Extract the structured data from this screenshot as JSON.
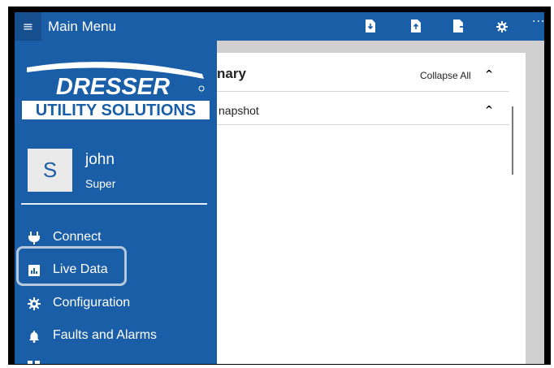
{
  "app": {
    "title": "Main Menu",
    "more": "···"
  },
  "content": {
    "section_title": "nary",
    "collapse_all": "Collapse All",
    "row_label": "napshot"
  },
  "nav": {
    "logo_top": "DRESSER",
    "logo_bottom": "UTILITY SOLUTIONS",
    "user": {
      "initial": "S",
      "name": "john",
      "role": "Super"
    },
    "items": [
      {
        "label": "Connect",
        "icon": "plug-icon"
      },
      {
        "label": "Live Data",
        "icon": "chart-icon"
      },
      {
        "label": "Configuration",
        "icon": "gear-icon"
      },
      {
        "label": "Faults and Alarms",
        "icon": "bell-icon"
      }
    ]
  }
}
